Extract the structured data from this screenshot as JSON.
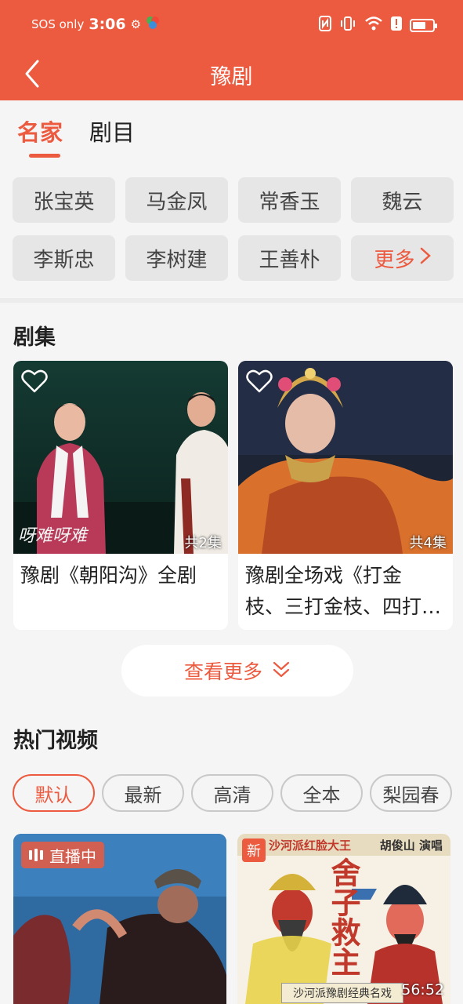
{
  "status_bar": {
    "carrier": "SOS only",
    "time": "3:06"
  },
  "header": {
    "title": "豫剧"
  },
  "tabs": [
    {
      "label": "名家"
    },
    {
      "label": "剧目"
    }
  ],
  "artists": [
    "张宝英",
    "马金凤",
    "常香玉",
    "魏云",
    "李斯忠",
    "李树建",
    "王善朴"
  ],
  "artists_more": "更多",
  "series_section": {
    "title": "剧集",
    "items": [
      {
        "title_line1": "豫剧《朝阳沟》全剧",
        "title_line2": "",
        "count": "共2集",
        "subtitle_caption": "呀难呀难"
      },
      {
        "title_line1": "豫剧全场戏《打金",
        "title_line2": "枝、三打金枝、四打…",
        "count": "共4集"
      }
    ],
    "more_label": "查看更多"
  },
  "hot_videos": {
    "title": "热门视频",
    "filters": [
      "默认",
      "最新",
      "高清",
      "全本",
      "梨园春"
    ],
    "active_filter": "默认",
    "videos": [
      {
        "badge": "直播中"
      },
      {
        "badge": "新",
        "duration": "56:52",
        "poster_top_left": "沙河派红脸大王",
        "poster_top_right": "胡俊山 演唱",
        "poster_title": "舍子救主",
        "poster_bottom": "沙河派豫剧经典名戏"
      }
    ]
  },
  "colors": {
    "accent": "#ec5a3f",
    "background": "#f5f5f5"
  }
}
